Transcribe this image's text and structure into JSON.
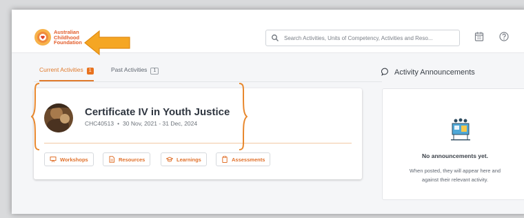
{
  "brand": {
    "logo_lines": [
      "Australian",
      "Childhood",
      "Foundation"
    ],
    "accent": "#e8721f",
    "annotation_color": "#f5a623"
  },
  "search": {
    "placeholder": "Search Activities, Units of Competency, Activities and Reso..."
  },
  "header_icons": [
    "calendar-icon",
    "help-icon"
  ],
  "tabs": [
    {
      "label": "Current Activities",
      "count": "1",
      "active": true
    },
    {
      "label": "Past Activities",
      "count": "1",
      "active": false
    }
  ],
  "course": {
    "title": "Certificate IV in Youth Justice",
    "code": "CHC40513",
    "separator": "•",
    "dates": "30 Nov, 2021 - 31 Dec, 2024",
    "buttons": [
      {
        "label": "Workshops",
        "icon": "workshop-icon"
      },
      {
        "label": "Resources",
        "icon": "document-icon"
      },
      {
        "label": "Learnings",
        "icon": "graduation-cap-icon"
      },
      {
        "label": "Assessments",
        "icon": "clipboard-icon"
      }
    ]
  },
  "announcements": {
    "title": "Activity Announcements",
    "empty_title": "No announcements yet.",
    "empty_line1": "When posted, they will appear here and",
    "empty_line2": "against their relevant activity."
  }
}
